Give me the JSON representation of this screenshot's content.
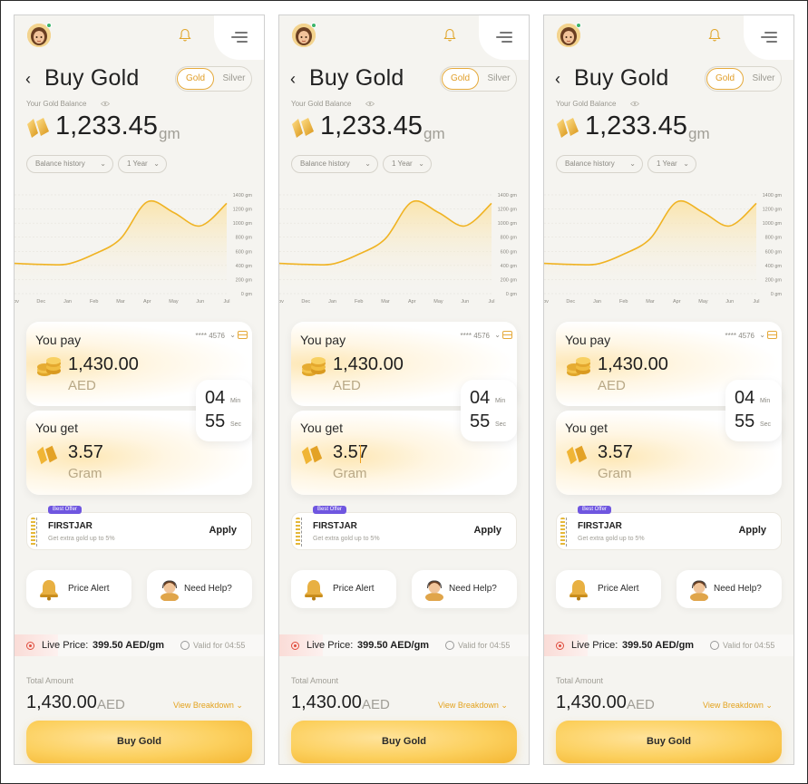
{
  "header": {
    "title": "Buy Gold",
    "back_icon": "chevron-left-icon",
    "notification_icon": "bell-icon",
    "menu_icon": "menu-icon"
  },
  "metal_toggle": {
    "gold_label": "Gold",
    "silver_label": "Silver",
    "selected": "Gold"
  },
  "balance": {
    "label": "Your Gold Balance",
    "value": "1,233.45",
    "unit": "gm"
  },
  "filters": {
    "history_label": "Balance history",
    "period_label": "1 Year"
  },
  "chart_data": {
    "type": "area",
    "title": "",
    "xlabel": "",
    "ylabel": "",
    "x": [
      "Nov",
      "Dec",
      "Jan",
      "Feb",
      "Mar",
      "Apr",
      "May",
      "Jun",
      "Jul"
    ],
    "y_ticks": [
      "1400 gm",
      "1200 gm",
      "1000 gm",
      "800 gm",
      "600 gm",
      "400 gm",
      "200 gm",
      "0 gm"
    ],
    "ylim": [
      0,
      1400
    ],
    "series": [
      {
        "values": [
          430,
          415,
          420,
          560,
          780,
          1300,
          1150,
          960,
          1280
        ]
      }
    ],
    "color": "#f0b323",
    "grid": true
  },
  "pay_card": {
    "label": "You pay",
    "amount": "1,430.00",
    "currency": "AED",
    "card_mask": "**** 4576"
  },
  "timer": {
    "minutes": "04",
    "minutes_label": "Min",
    "seconds": "55",
    "seconds_label": "Sec"
  },
  "get_card": {
    "label": "You get",
    "amount": "3.57",
    "unit": "Gram"
  },
  "offer": {
    "badge": "Best Offer",
    "code": "FIRSTJAR",
    "description": "Get extra gold up to 5%",
    "apply_label": "Apply"
  },
  "quick_actions": {
    "price_alert_label": "Price Alert",
    "help_label": "Need Help?"
  },
  "live_price": {
    "label": "Live Price:",
    "value": "399.50 AED/gm",
    "validity": "Valid for 04:55"
  },
  "total": {
    "label": "Total Amount",
    "value": "1,430.00",
    "currency": "AED",
    "breakdown_label": "View Breakdown"
  },
  "cta": {
    "label": "Buy Gold"
  }
}
